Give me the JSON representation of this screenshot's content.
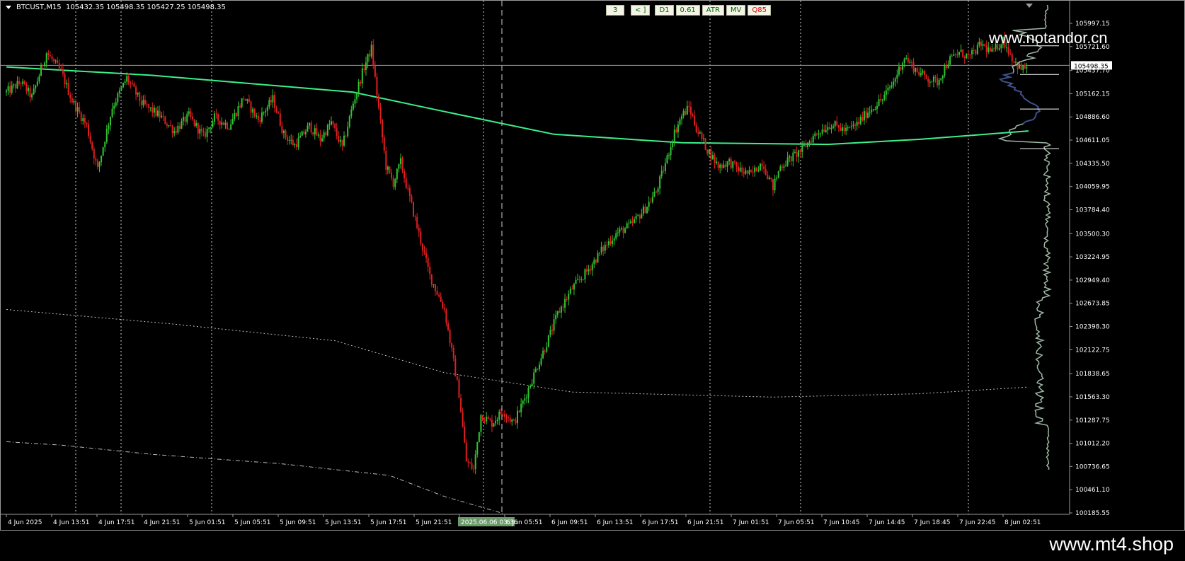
{
  "window": {
    "symbol_header": "BTCUST,M15  105432.35 105498.35 105427.25 105498.35"
  },
  "toolbar": {
    "buttons": [
      "3",
      "< ]",
      "D1",
      "0.61",
      "ATR",
      "MV",
      "Q85"
    ]
  },
  "watermarks": {
    "top": "www.notandor.cn",
    "bottom": "www.mt4.shop"
  },
  "colors": {
    "background": "#000000",
    "bull": "#31c431",
    "bear": "#e11f1f",
    "ma": "#3cf08a",
    "grid": "#ffffff",
    "profile_light": "#9fb8a6",
    "profile_dark": "#3e4f8a"
  },
  "chart_data": {
    "type": "candlestick",
    "symbol": "BTCUST",
    "timeframe": "M15",
    "ylim": [
      100185.55,
      106272.76
    ],
    "y_ticks": [
      "105997.15",
      "105721.60",
      "105437.70",
      "105162.15",
      "104886.60",
      "104611.05",
      "104335.50",
      "104059.95",
      "103784.40",
      "103500.30",
      "103224.95",
      "102949.40",
      "102673.85",
      "102398.30",
      "102122.75",
      "101838.65",
      "101563.30",
      "101287.75",
      "101012.20",
      "100736.65",
      "100461.10",
      "100185.55"
    ],
    "current_price": "105498.35",
    "x_ticks": [
      "4 Jun 2025",
      "4 Jun 13:51",
      "4 Jun 17:51",
      "4 Jun 21:51",
      "5 Jun 01:51",
      "5 Jun 05:51",
      "5 Jun 09:51",
      "5 Jun 13:51",
      "5 Jun 17:51",
      "5 Jun 21:51",
      "2025.06.06 03:36",
      "6 Jun 05:51",
      "6 Jun 09:51",
      "6 Jun 13:51",
      "6 Jun 17:51",
      "6 Jun 21:51",
      "7 Jun 01:51",
      "7 Jun 05:51",
      "7 Jun 10:45",
      "7 Jun 14:45",
      "7 Jun 18:45",
      "7 Jun 22:45",
      "8 Jun 02:51"
    ],
    "highlighted_x_tick": "2025.06.06 03:36",
    "close_path": [
      [
        0,
        105180
      ],
      [
        8,
        105300
      ],
      [
        14,
        105120
      ],
      [
        22,
        105650
      ],
      [
        30,
        105420
      ],
      [
        36,
        105080
      ],
      [
        44,
        104780
      ],
      [
        50,
        104260
      ],
      [
        58,
        105000
      ],
      [
        66,
        105350
      ],
      [
        74,
        105050
      ],
      [
        84,
        104900
      ],
      [
        92,
        104720
      ],
      [
        100,
        104900
      ],
      [
        108,
        104650
      ],
      [
        114,
        104880
      ],
      [
        122,
        104780
      ],
      [
        130,
        105120
      ],
      [
        138,
        104850
      ],
      [
        146,
        105100
      ],
      [
        152,
        104680
      ],
      [
        158,
        104550
      ],
      [
        166,
        104780
      ],
      [
        172,
        104620
      ],
      [
        178,
        104820
      ],
      [
        184,
        104520
      ],
      [
        190,
        105050
      ],
      [
        196,
        105480
      ],
      [
        200,
        105700
      ],
      [
        204,
        104980
      ],
      [
        208,
        104300
      ],
      [
        212,
        104100
      ],
      [
        216,
        104350
      ],
      [
        220,
        104000
      ],
      [
        226,
        103500
      ],
      [
        232,
        103000
      ],
      [
        236,
        102800
      ],
      [
        240,
        102600
      ],
      [
        244,
        102100
      ],
      [
        248,
        101600
      ],
      [
        252,
        100800
      ],
      [
        256,
        100700
      ],
      [
        260,
        101350
      ],
      [
        266,
        101250
      ],
      [
        272,
        101400
      ],
      [
        278,
        101250
      ],
      [
        284,
        101550
      ],
      [
        290,
        101880
      ],
      [
        296,
        102200
      ],
      [
        302,
        102550
      ],
      [
        310,
        102850
      ],
      [
        318,
        103050
      ],
      [
        326,
        103300
      ],
      [
        334,
        103500
      ],
      [
        342,
        103600
      ],
      [
        350,
        103800
      ],
      [
        356,
        104000
      ],
      [
        362,
        104400
      ],
      [
        366,
        104700
      ],
      [
        370,
        104900
      ],
      [
        374,
        105000
      ],
      [
        378,
        104750
      ],
      [
        384,
        104500
      ],
      [
        390,
        104300
      ],
      [
        396,
        104350
      ],
      [
        402,
        104250
      ],
      [
        408,
        104200
      ],
      [
        414,
        104350
      ],
      [
        420,
        104050
      ],
      [
        424,
        104300
      ],
      [
        430,
        104400
      ],
      [
        436,
        104500
      ],
      [
        444,
        104700
      ],
      [
        452,
        104800
      ],
      [
        460,
        104720
      ],
      [
        466,
        104800
      ],
      [
        472,
        104950
      ],
      [
        480,
        105100
      ],
      [
        486,
        105300
      ],
      [
        492,
        105600
      ],
      [
        498,
        105450
      ],
      [
        504,
        105350
      ],
      [
        510,
        105300
      ],
      [
        516,
        105550
      ],
      [
        522,
        105650
      ],
      [
        528,
        105600
      ],
      [
        534,
        105750
      ],
      [
        540,
        105650
      ],
      [
        546,
        105800
      ],
      [
        552,
        105550
      ],
      [
        556,
        105450
      ],
      [
        560,
        105500
      ]
    ],
    "series": [
      {
        "name": "MA",
        "color": "#3cf08a",
        "points": [
          [
            0,
            105480
          ],
          [
            80,
            105380
          ],
          [
            190,
            105180
          ],
          [
            240,
            104950
          ],
          [
            300,
            104680
          ],
          [
            370,
            104580
          ],
          [
            450,
            104560
          ],
          [
            500,
            104620
          ],
          [
            560,
            104720
          ]
        ]
      },
      {
        "name": "",
        "color": "#bbbbbb",
        "style": "dotted",
        "points": [
          [
            0,
            102600
          ],
          [
            90,
            102430
          ],
          [
            180,
            102230
          ],
          [
            240,
            101850
          ],
          [
            310,
            101620
          ],
          [
            420,
            101560
          ],
          [
            500,
            101600
          ],
          [
            560,
            101680
          ]
        ]
      },
      {
        "name": "",
        "color": "#bbbbbb",
        "style": "dashdot",
        "points": [
          [
            0,
            101030
          ],
          [
            30,
            100990
          ],
          [
            80,
            100880
          ],
          [
            150,
            100770
          ],
          [
            210,
            100630
          ],
          [
            240,
            100380
          ],
          [
            272,
            100180
          ]
        ]
      }
    ],
    "vlines_dotted": [
      1,
      2,
      4,
      10,
      15,
      17
    ],
    "vline_dashed": 11,
    "volume_profile_levels": [
      105730,
      105390,
      104980,
      104510
    ]
  }
}
